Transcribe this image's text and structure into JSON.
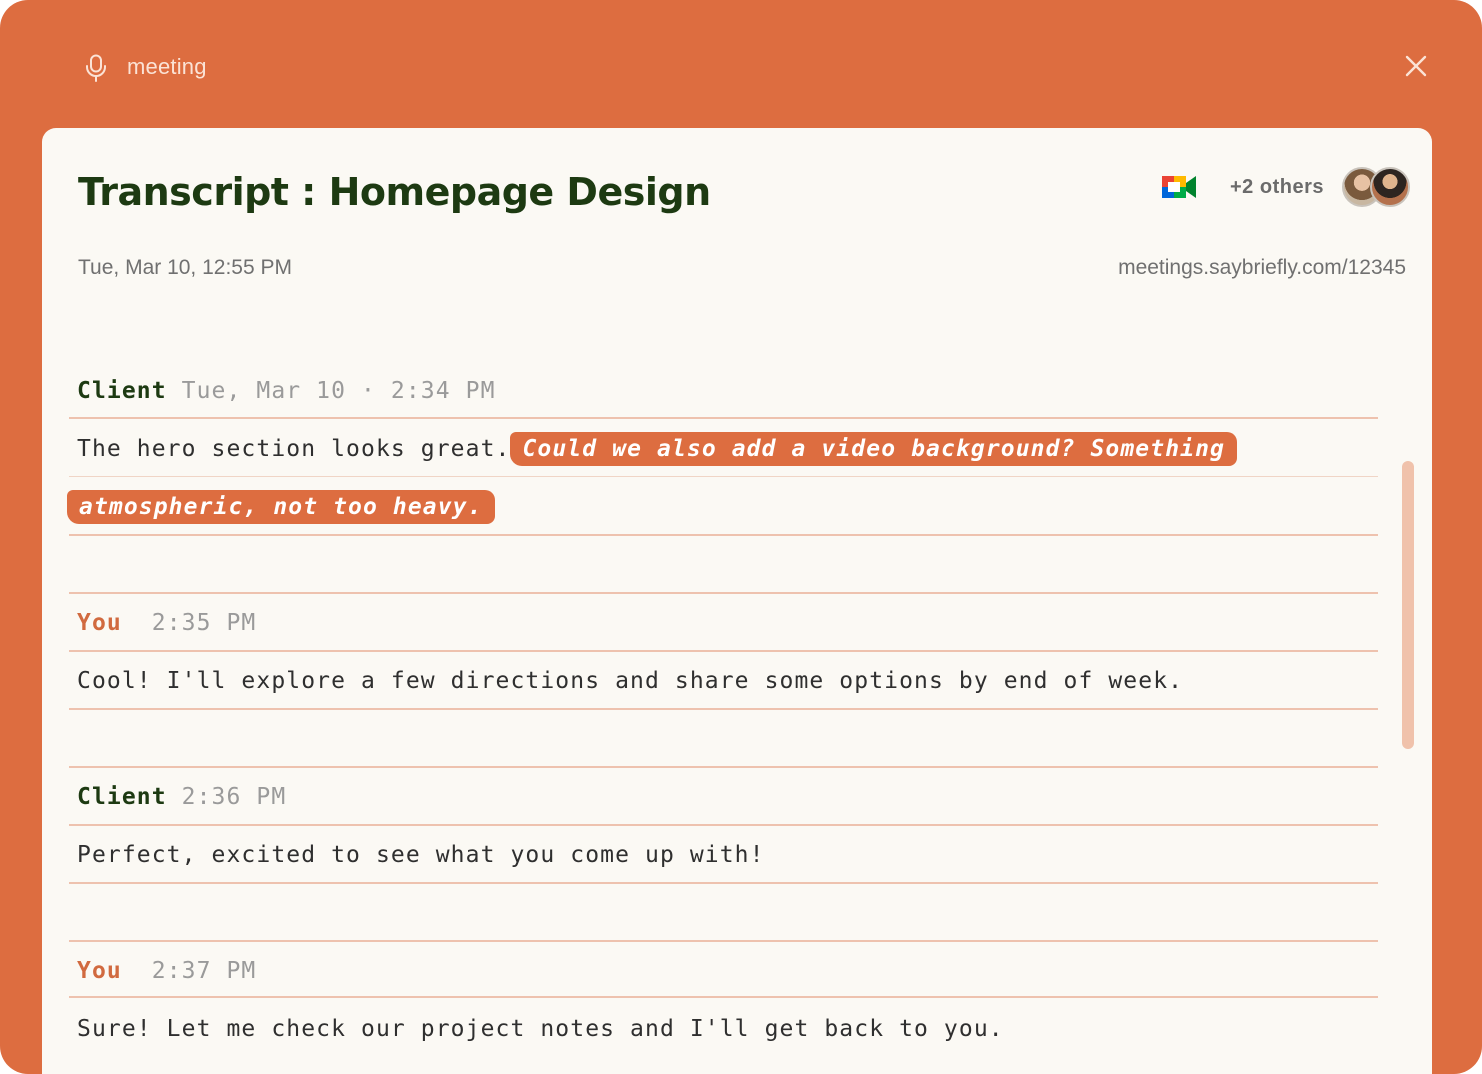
{
  "topbar": {
    "title": "meeting"
  },
  "header": {
    "title": "Transcript : Homepage Design",
    "date": "Tue, Mar 10, 12:55 PM",
    "url": "meetings.saybriefly.com/12345",
    "participants_label": "+2 others"
  },
  "transcript": [
    {
      "speaker": "Client",
      "time": "Tue, Mar 10 · 2:34 PM",
      "text": "The hero section looks great.",
      "highlight_line1": "Could we also add a video background? Something",
      "highlight_line2": "atmospheric, not too heavy."
    },
    {
      "speaker": "You",
      "time": "2:35 PM",
      "text": "Cool! I'll explore a few directions and share some options by end of week."
    },
    {
      "speaker": "Client",
      "time": "2:36 PM",
      "text": "Perfect, excited to see what you come up with!"
    },
    {
      "speaker": "You",
      "time": "2:37 PM",
      "text": "Sure! Let me check our project notes and I'll get back to you."
    }
  ],
  "colors": {
    "accent": "#dd6d40",
    "panel": "#fbf9f4",
    "heading": "#1d3a12"
  }
}
